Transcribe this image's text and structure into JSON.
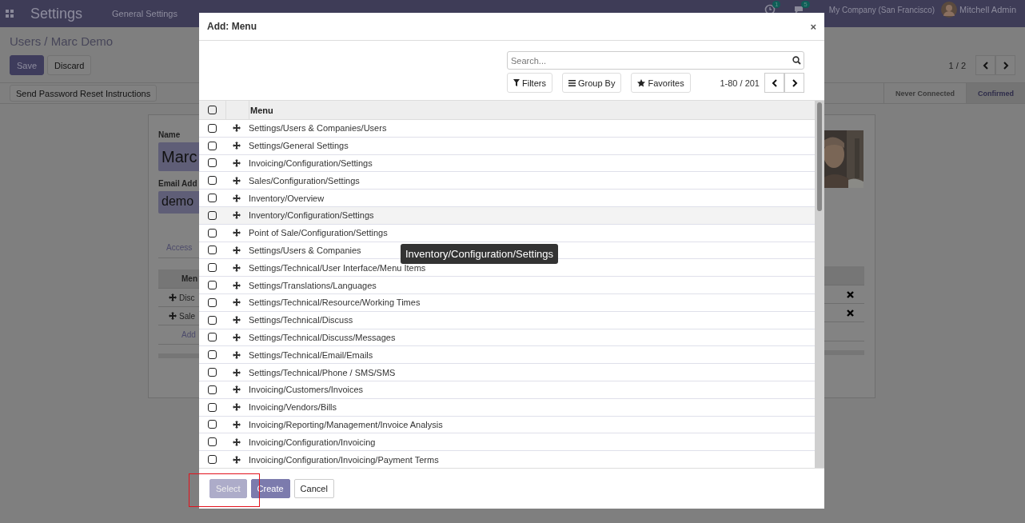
{
  "navbar": {
    "app_title": "Settings",
    "menu": [
      "General Settings"
    ],
    "activity_badge": "1",
    "message_badge": "5",
    "company": "My Company (San Francisco)",
    "user": "Mitchell Admin"
  },
  "breadcrumb": "Users / Marc Demo",
  "form_buttons": [
    {
      "label": "Save",
      "kind": "primary"
    },
    {
      "label": "Discard",
      "kind": "secondary"
    }
  ],
  "record_pager": "1 / 2",
  "header_button": "Send Password Reset Instructions",
  "status_steps": [
    {
      "label": "Never Connected",
      "selected": false
    },
    {
      "label": "Confirmed",
      "selected": true
    }
  ],
  "form": {
    "name_label": "Name",
    "name_value": "Marc",
    "email_label": "Email Add",
    "email_value": "demo",
    "tab": "Access",
    "table_header": "Men",
    "rows": [
      "Disc",
      "Sale"
    ],
    "add_line": "Add",
    "photo": {
      "kind": "picture"
    }
  },
  "dialog": {
    "title": "Add: Menu",
    "close": "×",
    "search": {
      "placeholder": "Search..."
    },
    "filters": [
      {
        "label": "Filters",
        "kind": "filter"
      },
      {
        "label": "Group By",
        "kind": "group"
      },
      {
        "label": "Favorites",
        "kind": "star"
      }
    ],
    "pager": "1-80 / 201",
    "column": "Menu",
    "all_checked": false,
    "rows": [
      {
        "label": "Settings/Users & Companies/Users",
        "checked": false
      },
      {
        "label": "Settings/General Settings",
        "checked": false
      },
      {
        "label": "Invoicing/Configuration/Settings",
        "checked": false
      },
      {
        "label": "Sales/Configuration/Settings",
        "checked": false
      },
      {
        "label": "Inventory/Overview",
        "checked": false
      },
      {
        "label": "Inventory/Configuration/Settings",
        "checked": false
      },
      {
        "label": "Point of Sale/Configuration/Settings",
        "checked": false
      },
      {
        "label": "Settings/Users & Companies",
        "checked": false
      },
      {
        "label": "Settings/Technical/User Interface/Menu Items",
        "checked": false
      },
      {
        "label": "Settings/Translations/Languages",
        "checked": false
      },
      {
        "label": "Settings/Technical/Resource/Working Times",
        "checked": false
      },
      {
        "label": "Settings/Technical/Discuss",
        "checked": false
      },
      {
        "label": "Settings/Technical/Discuss/Messages",
        "checked": false
      },
      {
        "label": "Settings/Technical/Email/Emails",
        "checked": false
      },
      {
        "label": "Settings/Technical/Phone / SMS/SMS",
        "checked": false
      },
      {
        "label": "Invoicing/Customers/Invoices",
        "checked": false
      },
      {
        "label": "Invoicing/Vendors/Bills",
        "checked": false
      },
      {
        "label": "Invoicing/Reporting/Management/Invoice Analysis",
        "checked": false
      },
      {
        "label": "Invoicing/Configuration/Invoicing",
        "checked": false
      },
      {
        "label": "Invoicing/Configuration/Invoicing/Payment Terms",
        "checked": false
      }
    ],
    "hovered": [
      false,
      false,
      false,
      false,
      false,
      true,
      false,
      false,
      false,
      false,
      false,
      false,
      false,
      false,
      false,
      false,
      false,
      false,
      false,
      false
    ],
    "tooltip": "Inventory/Configuration/Settings",
    "footer_buttons": [
      {
        "label": "Select",
        "kind": "primary",
        "disabled": true,
        "highlighted": true
      },
      {
        "label": "Create",
        "kind": "primary",
        "disabled": false,
        "highlighted": false
      },
      {
        "label": "Cancel",
        "kind": "secondary",
        "disabled": false,
        "highlighted": false
      }
    ]
  }
}
